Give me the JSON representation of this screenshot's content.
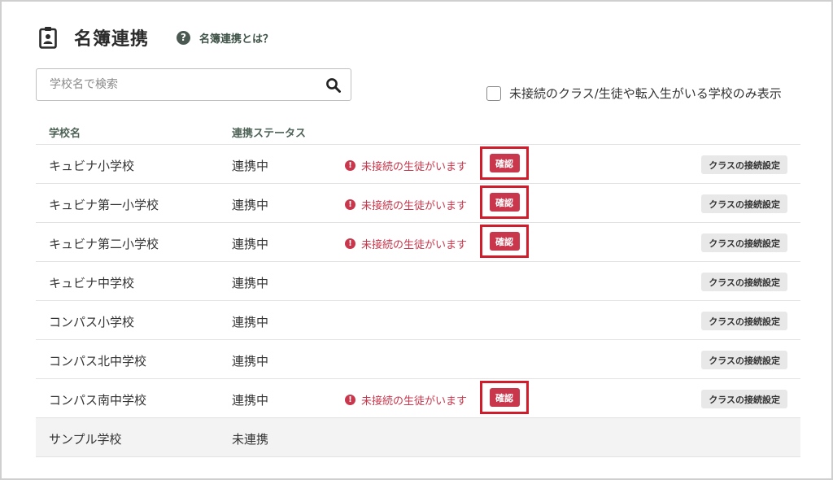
{
  "header": {
    "title": "名簿連携",
    "help_label": "名簿連携とは？",
    "help_icon_glyph": "?"
  },
  "search": {
    "placeholder": "学校名で検索",
    "value": ""
  },
  "filter": {
    "label": "未接続のクラス/生徒や転入生がいる学校のみ表示",
    "checked": false
  },
  "table": {
    "headers": {
      "name": "学校名",
      "status": "連携ステータス"
    },
    "warning_text": "未接続の生徒がいます",
    "confirm_label": "確認",
    "class_settings_label": "クラスの接続設定",
    "rows": [
      {
        "name": "キュビナ小学校",
        "status": "連携中"
      },
      {
        "name": "キュビナ第一小学校",
        "status": "連携中"
      },
      {
        "name": "キュビナ第二小学校",
        "status": "連携中"
      },
      {
        "name": "キュビナ中学校",
        "status": "連携中"
      },
      {
        "name": "コンパス小学校",
        "status": "連携中"
      },
      {
        "name": "コンパス北中学校",
        "status": "連携中"
      },
      {
        "name": "コンパス南中学校",
        "status": "連携中"
      },
      {
        "name": "サンプル学校",
        "status": "未連携"
      }
    ]
  },
  "colors": {
    "accent_red": "#c8374c",
    "highlight_border": "#d11c2c",
    "header_text_green": "#4e6257"
  },
  "icons": {
    "page_icon": "clipboard-id-icon",
    "search_icon": "search-icon",
    "warning_icon": "exclamation-circle-icon"
  }
}
